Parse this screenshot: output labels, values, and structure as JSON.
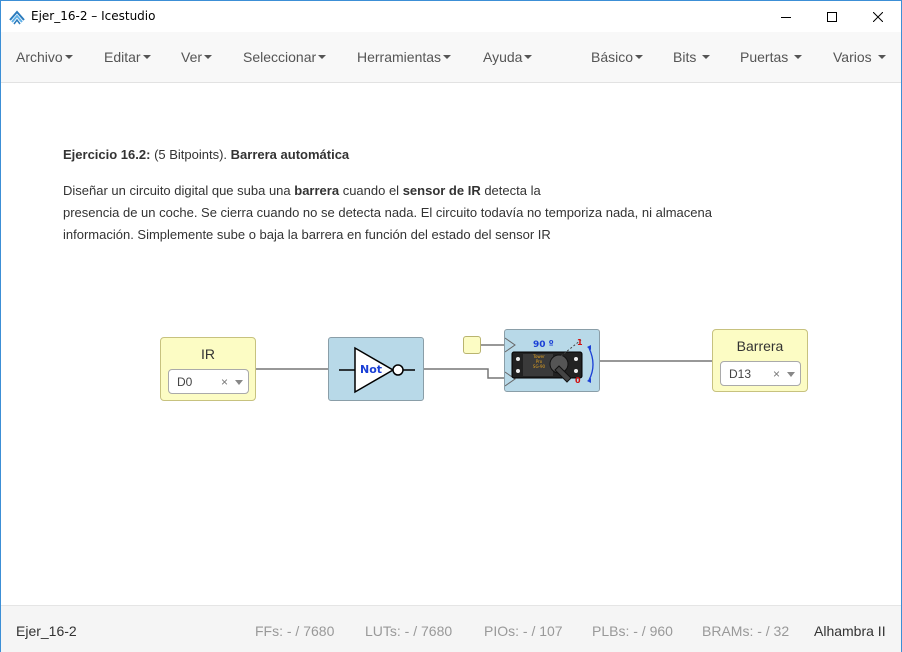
{
  "window": {
    "title": "Ejer_16-2 – Icestudio",
    "accent": "#3c8fd6"
  },
  "menus": {
    "left": [
      {
        "label": "Archivo"
      },
      {
        "label": "Editar"
      },
      {
        "label": "Ver"
      },
      {
        "label": "Seleccionar"
      },
      {
        "label": "Herramientas"
      },
      {
        "label": "Ayuda"
      }
    ],
    "right": [
      {
        "label": "Básico"
      },
      {
        "label": "Bits"
      },
      {
        "label": "Puertas"
      },
      {
        "label": "Varios"
      }
    ]
  },
  "info": {
    "heading_a": "Ejercicio 16.2:",
    "heading_b": " (5 Bitpoints). ",
    "heading_c": "Barrera automática",
    "line1_a": "Diseñar un circuito digital que suba una ",
    "line1_b": "barrera",
    "line1_c": " cuando el ",
    "line1_d": "sensor de IR",
    "line1_e": " detecta la",
    "line2": "presencia de un coche. Se cierra cuando no se detecta nada. El circuito todavía no temporiza nada, ni almacena",
    "line3": "información. Simplemente sube o baja la barrera en función del estado del sensor IR"
  },
  "circuit": {
    "input_block": {
      "name": "IR",
      "pin": "D0",
      "clear": "×"
    },
    "not_gate": {
      "label": "Not"
    },
    "servo": {
      "angle_label": "90 º",
      "high_label": "1",
      "low_label": "0",
      "text_1": "Tower",
      "text_2": "Pro",
      "text_3": "SG-90"
    },
    "output_block": {
      "name": "Barrera",
      "pin": "D13",
      "clear": "×"
    },
    "colors": {
      "io_fill": "#fcfcc4",
      "logic_fill": "#b8d9e8",
      "wire": "#777777"
    }
  },
  "status": {
    "project": "Ejer_16-2",
    "ffs": "FFs:  - / 7680",
    "luts": "LUTs:  - / 7680",
    "pios": "PIOs:  - / 107",
    "plbs": "PLBs:  - / 960",
    "brams": "BRAMs:  - / 32",
    "board": "Alhambra II"
  }
}
